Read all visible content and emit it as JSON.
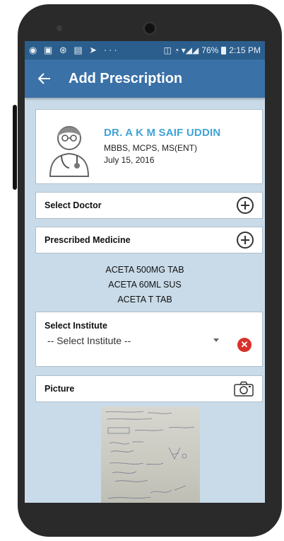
{
  "status_bar": {
    "battery": "76%",
    "time": "2:15 PM"
  },
  "app_bar": {
    "title": "Add Prescription"
  },
  "doctor": {
    "name": "DR. A K M SAIF UDDIN",
    "degrees": "MBBS, MCPS, MS(ENT)",
    "date": "July 15, 2016"
  },
  "select_doctor": {
    "label": "Select Doctor"
  },
  "prescribed_medicine": {
    "label": "Prescribed Medicine",
    "items": [
      "ACETA  500MG TAB",
      "ACETA 60ML SUS",
      "ACETA T TAB"
    ]
  },
  "institute": {
    "label": "Select Institute",
    "selected": "-- Select Institute --"
  },
  "picture": {
    "label": "Picture"
  },
  "icons": {
    "back": "arrow-left-icon",
    "add": "plus-circle-icon",
    "clear": "close-circle-icon",
    "camera": "camera-icon"
  },
  "colors": {
    "status_bar": "#2b5e8c",
    "app_bar": "#3a71a7",
    "background": "#c9dbe9",
    "doctor_name": "#3fa3d8",
    "clear": "#d8312b"
  }
}
